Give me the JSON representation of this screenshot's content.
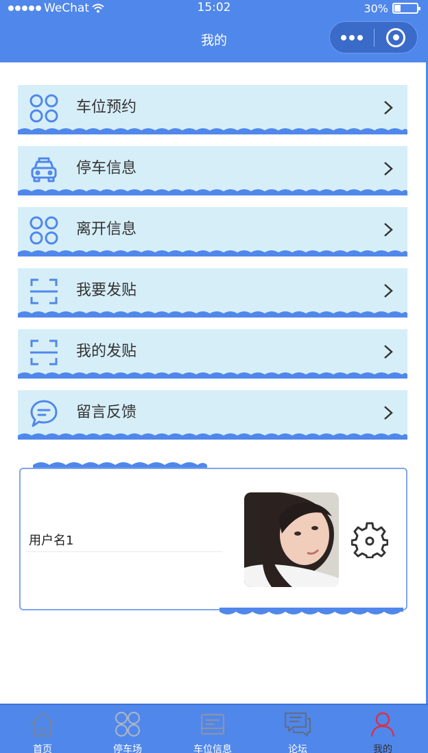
{
  "status_bar": {
    "carrier": "WeChat",
    "time": "15:02",
    "battery": "30%"
  },
  "navbar": {
    "title": "我的"
  },
  "menu": [
    {
      "label": "车位预约",
      "icon": "grid-four-circles-icon"
    },
    {
      "label": "停车信息",
      "icon": "car-icon"
    },
    {
      "label": "离开信息",
      "icon": "grid-four-circles-icon"
    },
    {
      "label": "我要发贴",
      "icon": "scan-frame-icon"
    },
    {
      "label": "我的发贴",
      "icon": "scan-frame-icon"
    },
    {
      "label": "留言反馈",
      "icon": "chat-bubble-icon"
    }
  ],
  "profile": {
    "username": "用户名1"
  },
  "tabbar": [
    {
      "label": "首页",
      "icon": "home-icon"
    },
    {
      "label": "停车场",
      "icon": "clover-icon"
    },
    {
      "label": "车位信息",
      "icon": "board-icon"
    },
    {
      "label": "论坛",
      "icon": "forum-chat-icon"
    },
    {
      "label": "我的",
      "icon": "user-icon",
      "active": true
    }
  ],
  "colors": {
    "primary": "#5087ea",
    "menu_bg": "#d6eef8",
    "active_tab": "#d9304a"
  }
}
